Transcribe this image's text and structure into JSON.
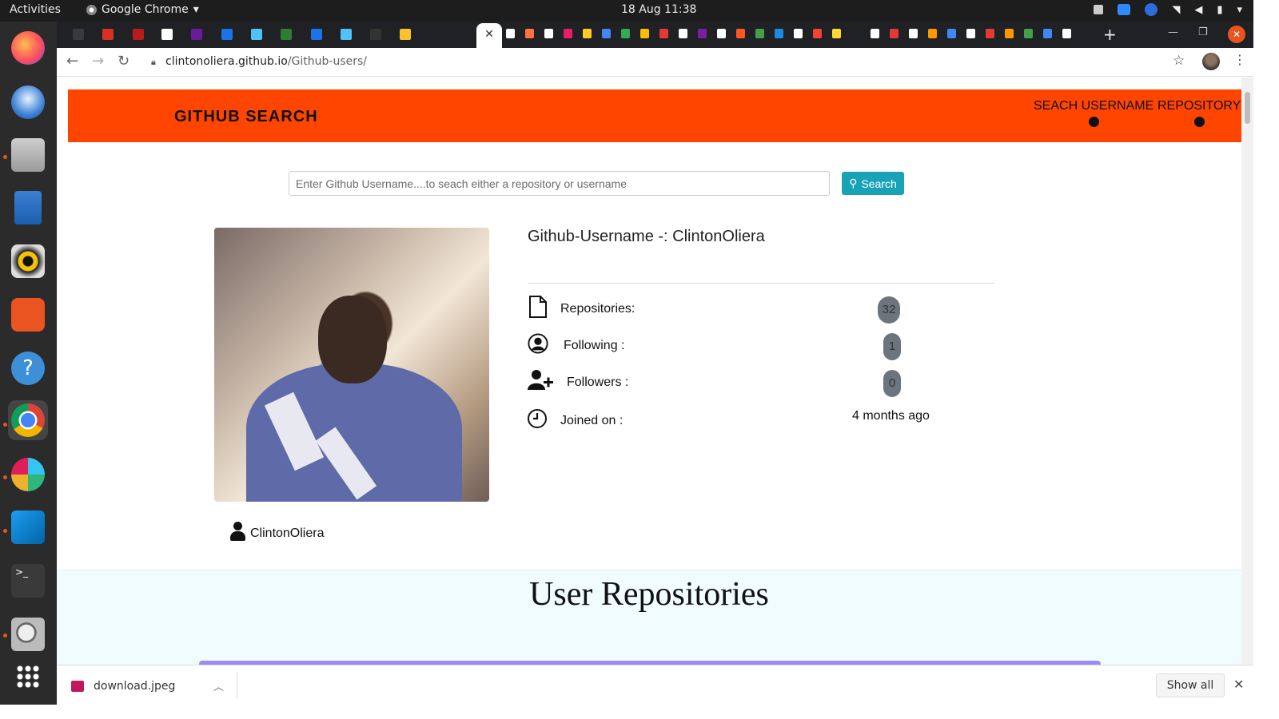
{
  "os": {
    "activities": "Activities",
    "app_name": "Google Chrome",
    "app_caret": "▾",
    "clock": "18 Aug  11:38"
  },
  "browser": {
    "url_host": "clintonoliera.github.io",
    "url_path": "/Github-users/",
    "active_tab_close": "✕",
    "new_tab": "+"
  },
  "site": {
    "brand": "GITHUB SEARCH",
    "nav": [
      "SEACH USERNAME",
      "REPOSITORY"
    ],
    "search_placeholder": "Enter Github Username....to seach either a repository or username",
    "search_button": "Search",
    "username_heading": "Github-Username -: ClintonOliera",
    "caption_name": "ClintonOliera",
    "stats": [
      {
        "label": "Repositories:",
        "value": "32",
        "icon": "file-icon"
      },
      {
        "label": "Following :",
        "value": "1",
        "icon": "user-circle-icon"
      },
      {
        "label": "Followers :",
        "value": "0",
        "icon": "user-plus-icon"
      },
      {
        "label": "Joined on :",
        "value": "4 months ago",
        "icon": "clock-icon"
      }
    ],
    "repos_title": "User Repositories"
  },
  "downloads": {
    "file": "download.jpeg",
    "show_all": "Show all"
  },
  "colors": {
    "navbar": "#ff4500",
    "search_button": "#17a2b8",
    "badge": "#6c757d",
    "repos_bg": "#f0fcfe",
    "repos_card": "#9b8cf5"
  }
}
